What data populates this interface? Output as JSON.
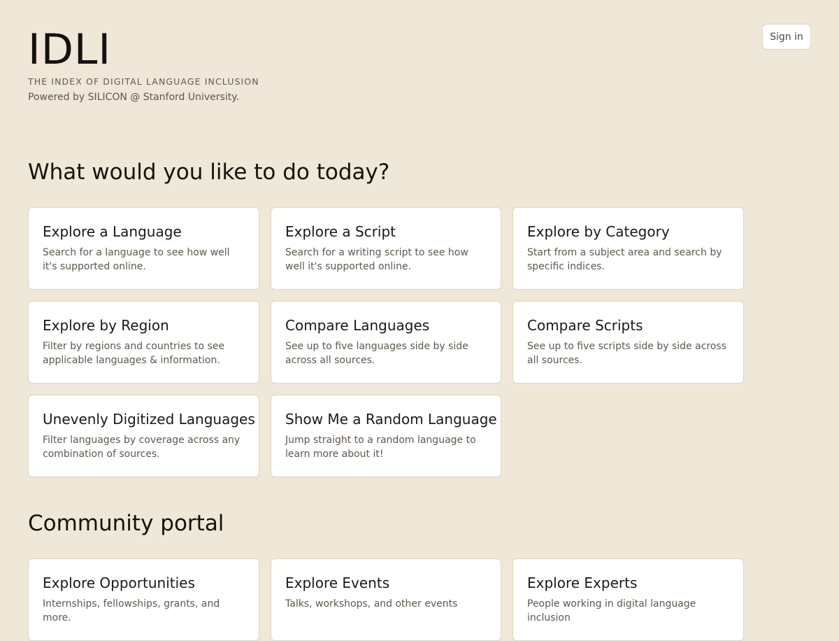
{
  "header": {
    "logo": "IDLI",
    "tagline": "THE INDEX OF DIGITAL LANGUAGE INCLUSION",
    "powered_by": "Powered by SILICON @ Stanford University.",
    "sign_in_label": "Sign in"
  },
  "tasks": {
    "heading": "What would you like to do today?",
    "cards": [
      {
        "title": "Explore a Language",
        "description": "Search for a language to see how well it's supported online."
      },
      {
        "title": "Explore a Script",
        "description": "Search for a writing script to see how well it's supported online."
      },
      {
        "title": "Explore by Category",
        "description": "Start from a subject area and search by specific indices."
      },
      {
        "title": "Explore by Region",
        "description": "Filter by regions and countries to see applicable languages & information."
      },
      {
        "title": "Compare Languages",
        "description": "See up to five languages side by side across all sources."
      },
      {
        "title": "Compare Scripts",
        "description": "See up to five scripts side by side across all sources."
      },
      {
        "title": "Unevenly Digitized Languages",
        "description": "Filter languages by coverage across any combination of sources."
      },
      {
        "title": "Show Me a Random Language",
        "description": "Jump straight to a random language to learn more about it!"
      }
    ]
  },
  "community": {
    "heading": "Community portal",
    "cards": [
      {
        "title": "Explore Opportunities",
        "description": "Internships, fellowships, grants, and more."
      },
      {
        "title": "Explore Events",
        "description": "Talks, workshops, and other events"
      },
      {
        "title": "Explore Experts",
        "description": "People working in digital language inclusion"
      }
    ]
  }
}
